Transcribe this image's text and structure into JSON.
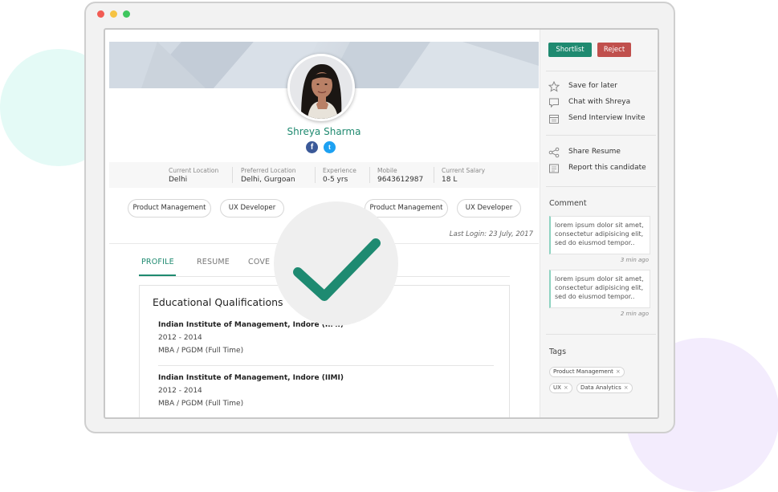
{
  "window": {
    "controls": [
      "close",
      "minimize",
      "maximize"
    ]
  },
  "profile": {
    "name": "Shreya Sharma",
    "social": [
      "facebook-icon",
      "twitter-icon"
    ],
    "info": [
      {
        "label": "Current Location",
        "value": "Delhi"
      },
      {
        "label": "Preferred Location",
        "value": "Delhi, Gurgoan"
      },
      {
        "label": "Experience",
        "value": "0-5 yrs"
      },
      {
        "label": "Mobile",
        "value": "9643612987"
      },
      {
        "label": "Current Salary",
        "value": "18 L"
      }
    ],
    "skills": [
      "Product Management",
      "UX Developer",
      "Product Management",
      "UX Developer"
    ],
    "last_login": "Last Login: 23 July, 2017"
  },
  "tabs": [
    {
      "label": "PROFILE",
      "active": true
    },
    {
      "label": "RESUME",
      "active": false
    },
    {
      "label": "COVE",
      "active": false
    }
  ],
  "education": {
    "title": "Educational Qualifications",
    "items": [
      {
        "institute": "Indian Institute of Management, Indore (IIMI)",
        "years": "2012 - 2014",
        "degree": "MBA / PGDM (Full Time)"
      },
      {
        "institute": "Indian Institute of Management, Indore (IIMI)",
        "years": "2012 - 2014",
        "degree": "MBA / PGDM (Full Time)"
      }
    ]
  },
  "sidebar": {
    "shortlist_label": "Shortlist",
    "reject_label": "Reject",
    "actions": [
      {
        "label": "Save for later",
        "icon": "star-icon"
      },
      {
        "label": "Chat with Shreya",
        "icon": "chat-icon"
      },
      {
        "label": "Send Interview Invite",
        "icon": "calendar-icon"
      }
    ],
    "actions2": [
      {
        "label": "Share Resume",
        "icon": "share-icon"
      },
      {
        "label": "Report this candidate",
        "icon": "report-icon"
      }
    ],
    "comment_heading": "Comment",
    "comments": [
      {
        "text": "lorem ipsum dolor sit amet, consectetur adipisicing elit, sed do eiusmod tempor..",
        "time": "3 min ago"
      },
      {
        "text": "lorem ipsum dolor sit amet, consectetur adipisicing elit, sed do eiusmod tempor..",
        "time": "2 min ago"
      }
    ],
    "tags_heading": "Tags",
    "tags": [
      "Product Management",
      "UX",
      "Data Analytics"
    ]
  },
  "colors": {
    "accent": "#1f8a70",
    "reject": "#c0504d"
  },
  "overlay": {
    "icon": "checkmark-icon"
  }
}
